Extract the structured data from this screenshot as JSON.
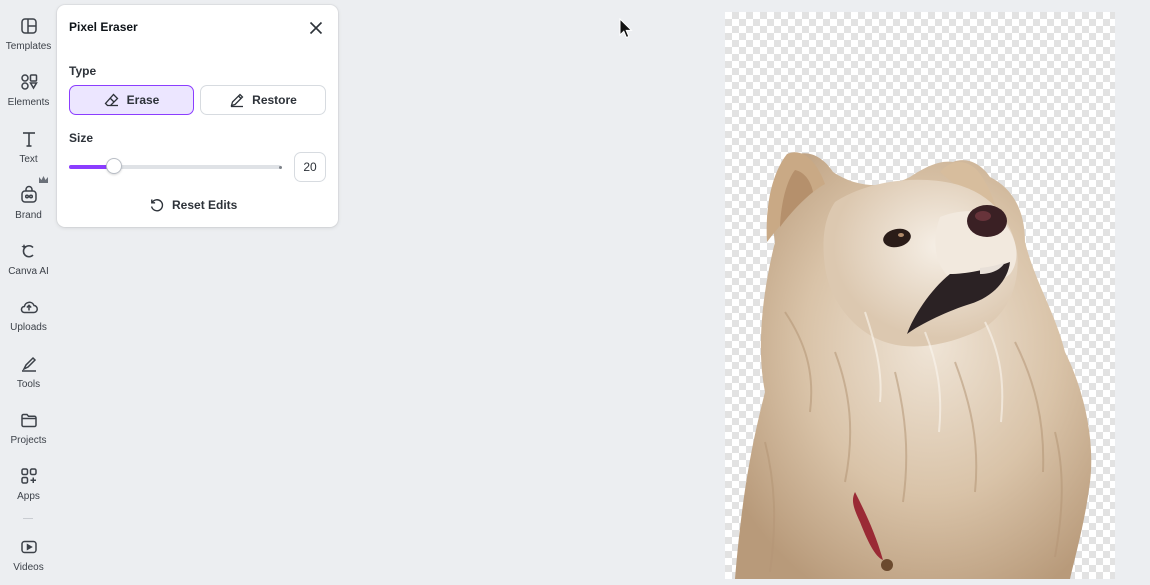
{
  "sidebar": {
    "items": [
      {
        "label": "Templates",
        "icon": "templates-icon"
      },
      {
        "label": "Elements",
        "icon": "elements-icon"
      },
      {
        "label": "Text",
        "icon": "text-icon"
      },
      {
        "label": "Brand",
        "icon": "brand-icon"
      },
      {
        "label": "Canva AI",
        "icon": "canva-ai-icon"
      },
      {
        "label": "Uploads",
        "icon": "uploads-icon"
      },
      {
        "label": "Tools",
        "icon": "tools-icon"
      },
      {
        "label": "Projects",
        "icon": "projects-icon"
      },
      {
        "label": "Apps",
        "icon": "apps-icon"
      },
      {
        "label": "Videos",
        "icon": "videos-icon"
      }
    ]
  },
  "panel": {
    "title": "Pixel Eraser",
    "type_label": "Type",
    "erase_label": "Erase",
    "restore_label": "Restore",
    "selected_type": "Erase",
    "size_label": "Size",
    "size_value": "20",
    "size_fraction": 0.21,
    "reset_label": "Reset Edits"
  },
  "colors": {
    "accent": "#8b3dff",
    "selected_bg": "#ece6ff",
    "app_bg": "#eceef1"
  }
}
